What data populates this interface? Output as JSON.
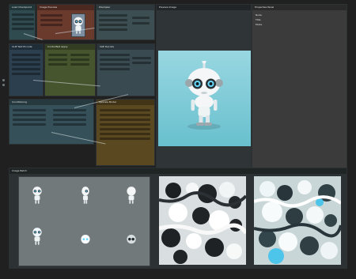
{
  "app": {
    "sidebar_icon": "node-graph-icon"
  },
  "nodes": {
    "top_left": {
      "title": "Load Checkpoint"
    },
    "top_mid": {
      "title": "Image Preview"
    },
    "top_right": {
      "title": "KSampler"
    },
    "mid_left": {
      "title": "CLIP Text Encode"
    },
    "mid_center": {
      "title": "ControlNet Apply"
    },
    "mid_right": {
      "title": "VAE Decode"
    },
    "bottom_left": {
      "title": "Conditioning"
    },
    "bottom_right": {
      "title": "Upscale Model"
    }
  },
  "preview": {
    "title": "Preview Image",
    "selected_label": "1"
  },
  "properties": {
    "title": "Properties Panel",
    "items": [
      "Node",
      "Title",
      "Mode"
    ]
  },
  "gallery": {
    "title": "Image Batch",
    "left_label": "Sprite Sheet",
    "mid_label": "Normal Map",
    "right_label": "Albedo"
  },
  "icons": {
    "close": "close-icon",
    "menu": "menu-icon"
  }
}
